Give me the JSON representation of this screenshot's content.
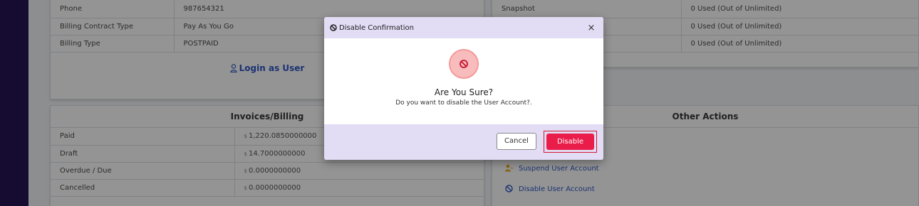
{
  "user_details": {
    "rows": [
      {
        "label": "Phone",
        "value": "987654321"
      },
      {
        "label": "Billing Contract Type",
        "value": "Pay As You Go"
      },
      {
        "label": "Billing Type",
        "value": "POSTPAID"
      }
    ],
    "login_link": "Login as User"
  },
  "usage": {
    "rows": [
      {
        "label": "Snapshot",
        "value": "0 Used (Out of Unlimited)"
      },
      {
        "label": "",
        "value": "0 Used (Out of Unlimited)"
      },
      {
        "label": "",
        "value": "0 Used (Out of Unlimited)"
      }
    ]
  },
  "invoices": {
    "title": "Invoices/Billing",
    "currency_symbol": "$",
    "rows": [
      {
        "label": "Paid",
        "amount": "1,220.0850000000"
      },
      {
        "label": "Draft",
        "amount": "14.7000000000"
      },
      {
        "label": "Overdue / Due",
        "amount": "0.0000000000"
      },
      {
        "label": "Cancelled",
        "amount": "0.0000000000"
      }
    ]
  },
  "other_actions": {
    "title": "Other Actions",
    "items": [
      {
        "label": "Suspend User Account",
        "icon": "user-minus-icon"
      },
      {
        "label": "Disable User Account",
        "icon": "ban-icon"
      }
    ]
  },
  "modal": {
    "title": "Disable Confirmation",
    "close": "×",
    "heading": "Are You Sure?",
    "message": "Do you want to disable the User Account?.",
    "cancel_label": "Cancel",
    "confirm_label": "Disable"
  },
  "colors": {
    "sidebar": "#261655",
    "link": "#2f58c5",
    "modal_band": "#e2dcf5",
    "danger": "#ea1d4a"
  }
}
